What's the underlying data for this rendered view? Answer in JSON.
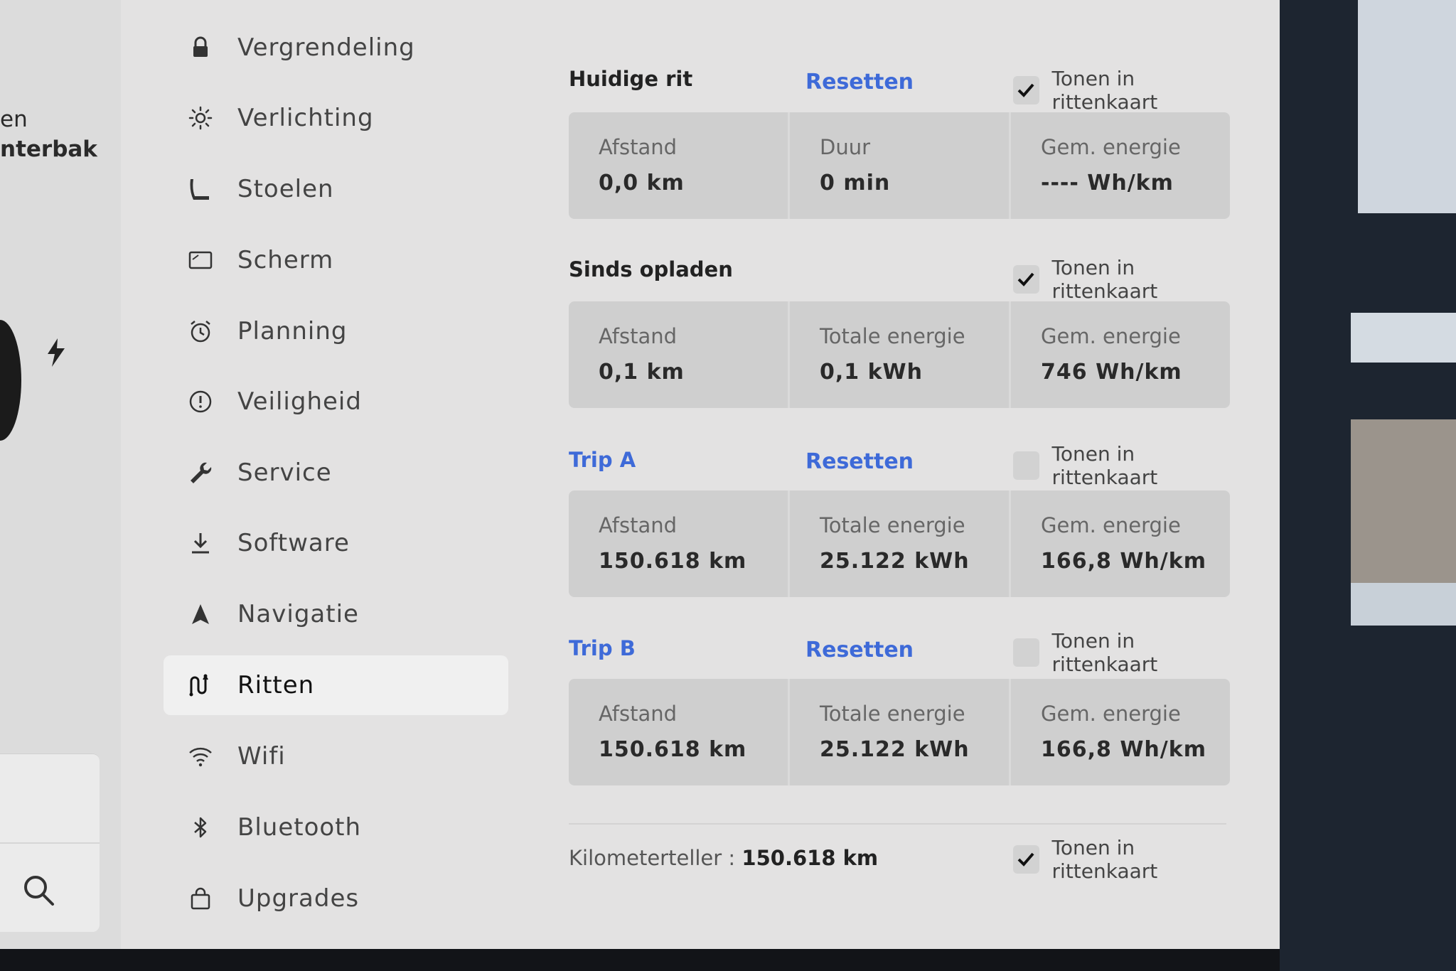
{
  "left_strip": {
    "line1": "en",
    "line2": "nterbak"
  },
  "nav": [
    {
      "label": "Vergrendeling",
      "icon": "lock-icon"
    },
    {
      "label": "Verlichting",
      "icon": "sun-icon"
    },
    {
      "label": "Stoelen",
      "icon": "seat-icon"
    },
    {
      "label": "Scherm",
      "icon": "display-icon"
    },
    {
      "label": "Planning",
      "icon": "alarm-clock-icon"
    },
    {
      "label": "Veiligheid",
      "icon": "alert-circle-icon"
    },
    {
      "label": "Service",
      "icon": "wrench-icon"
    },
    {
      "label": "Software",
      "icon": "download-icon"
    },
    {
      "label": "Navigatie",
      "icon": "navigation-arrow-icon"
    },
    {
      "label": "Ritten",
      "icon": "trips-icon",
      "active": true
    },
    {
      "label": "Wifi",
      "icon": "wifi-icon"
    },
    {
      "label": "Bluetooth",
      "icon": "bluetooth-icon"
    },
    {
      "label": "Upgrades",
      "icon": "shopping-bag-icon"
    }
  ],
  "sections": {
    "current": {
      "title": "Huidige rit",
      "reset": "Resetten",
      "toggle_label": "Tonen in rittenkaart",
      "checked": true,
      "stats": [
        {
          "label": "Afstand",
          "value": "0,0  km"
        },
        {
          "label": "Duur",
          "value": "0  min"
        },
        {
          "label": "Gem. energie",
          "value": "----  Wh/km"
        }
      ]
    },
    "since_charge": {
      "title": "Sinds opladen",
      "toggle_label": "Tonen in rittenkaart",
      "checked": true,
      "stats": [
        {
          "label": "Afstand",
          "value": "0,1  km"
        },
        {
          "label": "Totale energie",
          "value": "0,1  kWh"
        },
        {
          "label": "Gem. energie",
          "value": "746  Wh/km"
        }
      ]
    },
    "trip_a": {
      "title": "Trip A",
      "reset": "Resetten",
      "toggle_label": "Tonen in rittenkaart",
      "checked": false,
      "stats": [
        {
          "label": "Afstand",
          "value": "150.618  km"
        },
        {
          "label": "Totale energie",
          "value": "25.122  kWh"
        },
        {
          "label": "Gem. energie",
          "value": "166,8  Wh/km"
        }
      ]
    },
    "trip_b": {
      "title": "Trip B",
      "reset": "Resetten",
      "toggle_label": "Tonen in rittenkaart",
      "checked": false,
      "stats": [
        {
          "label": "Afstand",
          "value": "150.618  km"
        },
        {
          "label": "Totale energie",
          "value": "25.122  kWh"
        },
        {
          "label": "Gem. energie",
          "value": "166,8  Wh/km"
        }
      ]
    }
  },
  "odometer": {
    "label": "Kilometerteller  :",
    "value": "150.618  km",
    "toggle_label": "Tonen in rittenkaart",
    "checked": true
  },
  "colors": {
    "accent": "#3e6ad8",
    "screen_bg": "#e3e2e2",
    "card_bg": "#cfcfcf"
  }
}
